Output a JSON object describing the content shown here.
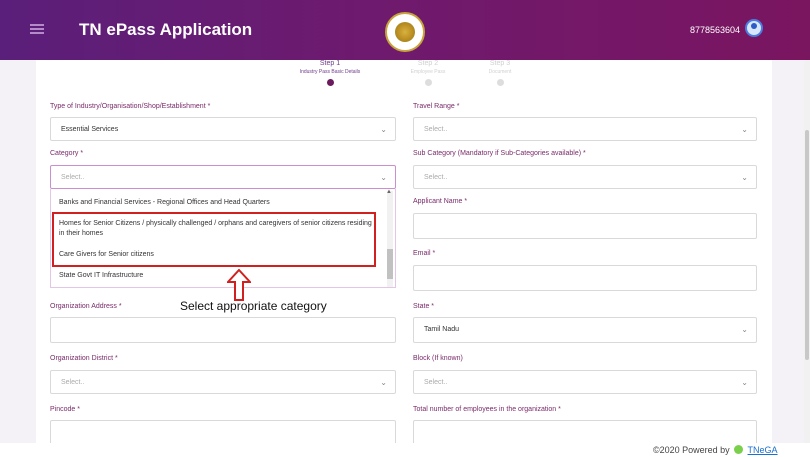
{
  "header": {
    "title": "TN ePass Application",
    "phone": "8778563604"
  },
  "steps": [
    {
      "title": "Step 1",
      "desc": "Industry Pass Basic Details"
    },
    {
      "title": "Step 2",
      "desc": "Employee Pass"
    },
    {
      "title": "Step 3",
      "desc": "Document"
    }
  ],
  "form": {
    "industry_type": {
      "label": "Type of Industry/Organisation/Shop/Establishment *",
      "value": "Essential Services"
    },
    "travel_range": {
      "label": "Travel Range *",
      "placeholder": "Select.."
    },
    "category": {
      "label": "Category *",
      "placeholder": "Select..",
      "options": [
        "Banks and Financial Services - Regional Offices and Head Quarters",
        "Homes for Senior Citizens / physically challenged / orphans and caregivers of senior citizens residing in their homes",
        "Care Givers for Senior citizens",
        "State Govt IT Infrastructure"
      ]
    },
    "sub_category": {
      "label": "Sub Category (Mandatory if Sub-Categories available) *",
      "placeholder": "Select.."
    },
    "applicant_name": {
      "label": "Applicant Name *"
    },
    "email": {
      "label": "Email *"
    },
    "org_address": {
      "label": "Organization Address *"
    },
    "state": {
      "label": "State *",
      "value": "Tamil Nadu"
    },
    "org_district": {
      "label": "Organization District *",
      "placeholder": "Select.."
    },
    "block": {
      "label": "Block (If known)",
      "placeholder": "Select.."
    },
    "pincode": {
      "label": "Pincode *"
    },
    "employees": {
      "label": "Total number of employees in the organization *"
    }
  },
  "annotation": "Select appropriate  category",
  "footer": {
    "text": "©2020 Powered by",
    "brand": "TNeGA"
  },
  "colors": {
    "header_start": "#5a1f7a",
    "header_end": "#7a1560",
    "highlight": "#d02020",
    "label": "#7a2a6a"
  }
}
